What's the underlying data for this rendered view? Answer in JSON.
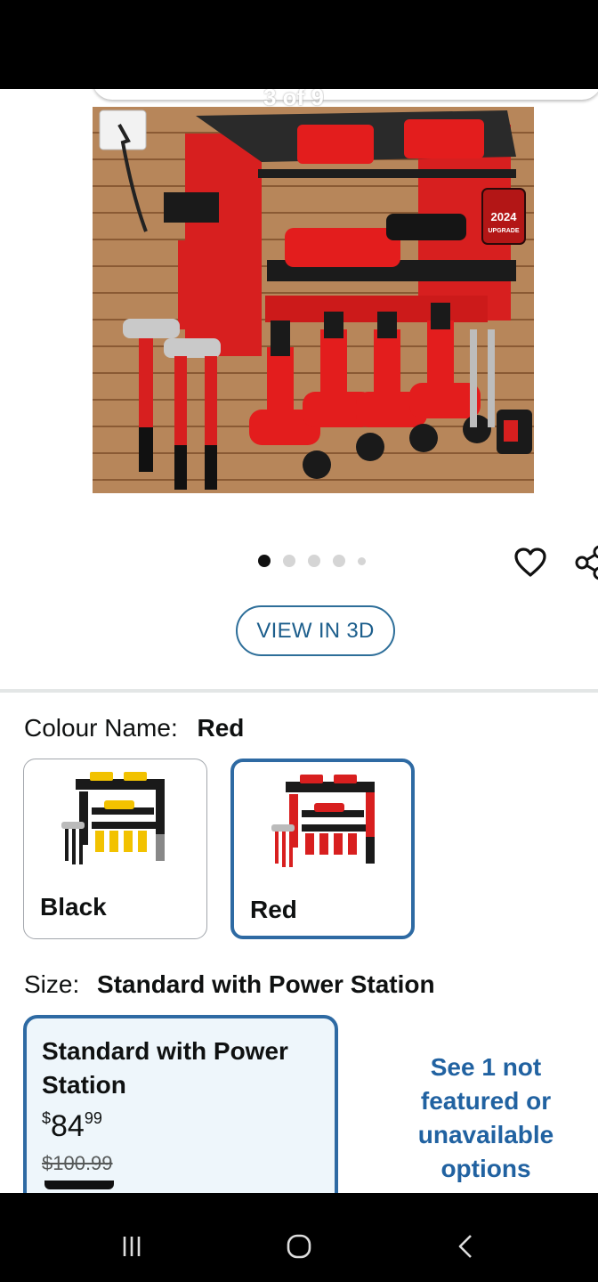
{
  "gallery": {
    "counter": "3 of 9",
    "badge_year": "2024",
    "badge_text": "UPGRADE",
    "dots_total": 5,
    "dots_active": 1,
    "view_3d_label": "VIEW IN 3D"
  },
  "colour": {
    "label": "Colour Name:",
    "value": "Red",
    "options": [
      {
        "name": "Black",
        "selected": false,
        "accent": "#f2c200"
      },
      {
        "name": "Red",
        "selected": true,
        "accent": "#d81f1f"
      }
    ]
  },
  "size": {
    "label": "Size:",
    "value": "Standard with Power Station",
    "card": {
      "title": "Standard with Power Station",
      "currency": "$",
      "price_whole": "84",
      "price_fraction": "99",
      "list_price": "$100.99"
    },
    "more_options": "See 1 not featured or unavailable options"
  },
  "icons": {
    "close": "close-icon",
    "wishlist": "heart-icon",
    "share": "share-icon",
    "recents": "recent-apps-icon",
    "home": "home-icon",
    "back": "back-icon"
  },
  "colors": {
    "link": "#2162a1",
    "selected_border": "#2e6aa3",
    "selected_bg": "#eef6fb"
  }
}
